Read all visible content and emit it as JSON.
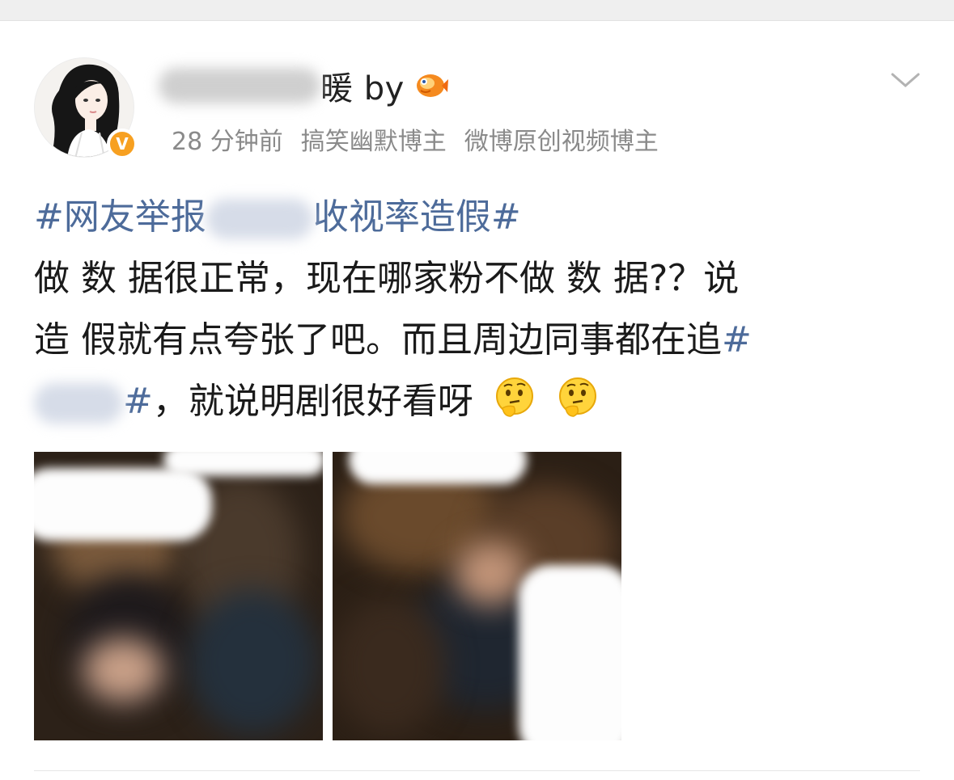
{
  "header": {
    "username_visible": "暖 by",
    "verified_badge": "V",
    "badge_icon": "fish-icon",
    "avatar_icon": "avatar-girl-icon",
    "more_icon": "chevron-down-icon",
    "meta": {
      "time": "28 分钟前",
      "tag1": "搞笑幽默博主",
      "tag2": "微博原创视频博主"
    }
  },
  "content": {
    "topic_start": "#网友举报",
    "topic_end": "收视率造假#",
    "line2": "做 数 据很正常，现在哪家粉不做 数 据?？说",
    "line3_text": "造 假就有点夸张了吧。而且周边同事都在追",
    "line3_hash": "#",
    "line4_hash": "#",
    "line4_text": "，就说明剧很好看呀",
    "emoji_icon": "thinking-face-icon"
  },
  "media": {
    "photo_left": "photo-thumbnail-1",
    "photo_right": "photo-thumbnail-2"
  },
  "colors": {
    "topic": "#4d6b9a",
    "meta": "#8a8a8a",
    "badge": "#f7a021"
  }
}
